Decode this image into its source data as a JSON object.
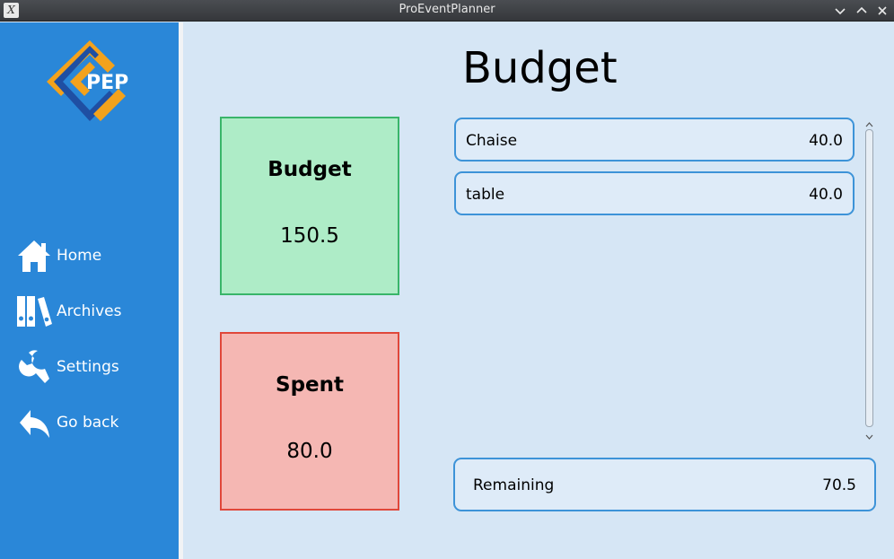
{
  "window": {
    "title": "ProEventPlanner"
  },
  "logo": {
    "text": "PEP",
    "colors": {
      "blue": "#1f4fa3",
      "orange": "#f3a21c"
    }
  },
  "sidebar": {
    "items": [
      {
        "label": "Home",
        "icon": "home-icon"
      },
      {
        "label": "Archives",
        "icon": "archives-icon"
      },
      {
        "label": "Settings",
        "icon": "wrench-icon"
      },
      {
        "label": "Go back",
        "icon": "back-arrow-icon"
      }
    ]
  },
  "main": {
    "title": "Budget",
    "budget_card": {
      "title": "Budget",
      "value": "150.5"
    },
    "spent_card": {
      "title": "Spent",
      "value": "80.0"
    },
    "items": [
      {
        "name": "Chaise",
        "amount": "40.0"
      },
      {
        "name": "table",
        "amount": "40.0"
      }
    ],
    "remaining": {
      "label": "Remaining",
      "value": "70.5"
    }
  },
  "colors": {
    "sidebar": "#2a87d8",
    "background": "#d6e6f5",
    "budget_fill": "#aeecc7",
    "spent_fill": "#f5b7b3",
    "accent_border": "#3d93d8"
  }
}
